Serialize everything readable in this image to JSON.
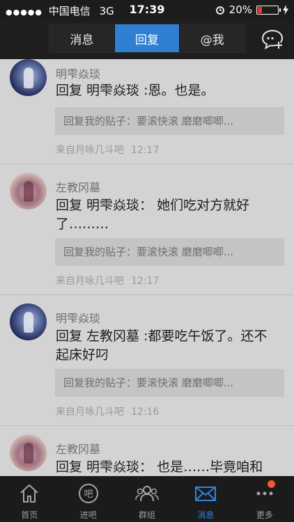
{
  "status_bar": {
    "signal": "●●●●●",
    "carrier": "中国电信",
    "network": "3G",
    "time": "17:39",
    "battery": "20%",
    "battery_level": 0.2
  },
  "nav": {
    "tabs": [
      {
        "label": "消息",
        "active": false
      },
      {
        "label": "回复",
        "active": true
      },
      {
        "label": "@我",
        "active": false
      }
    ],
    "compose_icon": "new-message-icon"
  },
  "posts": [
    {
      "author": "明雫焱琰",
      "message": "回复 明雫焱琰 :恩。也是。",
      "quote": "回复我的贴子：要滚快滚 磨磨唧唧...",
      "source": "来自月咏几斗吧",
      "time": "12:17"
    },
    {
      "author": "左教冈墓",
      "message": "回复 明雫焱琰： 她们吃对方就好了………",
      "quote": "回复我的贴子：要滚快滚 磨磨唧唧...",
      "source": "来自月咏几斗吧",
      "time": "12:17"
    },
    {
      "author": "明雫焱琰",
      "message": "回复 左教冈墓 :都要吃午饭了。还不起床好叼",
      "quote": "回复我的贴子：要滚快滚 磨磨唧唧...",
      "source": "来自月咏几斗吧",
      "time": "12:16"
    },
    {
      "author": "左教冈墓",
      "message": "回复 明雫焱琰： 也是……毕竟咱和"
    }
  ],
  "tab_bar": [
    {
      "label": "首页",
      "icon": "home-icon",
      "active": false
    },
    {
      "label": "进吧",
      "icon": "enter-bar-icon",
      "active": false
    },
    {
      "label": "群组",
      "icon": "group-icon",
      "active": false
    },
    {
      "label": "消息",
      "icon": "mail-icon",
      "active": true
    },
    {
      "label": "更多",
      "icon": "more-icon",
      "active": false,
      "badge": true
    }
  ],
  "colors": {
    "accent": "#2f7fd3",
    "badge": "#f0582d",
    "battery": "#e33333"
  }
}
